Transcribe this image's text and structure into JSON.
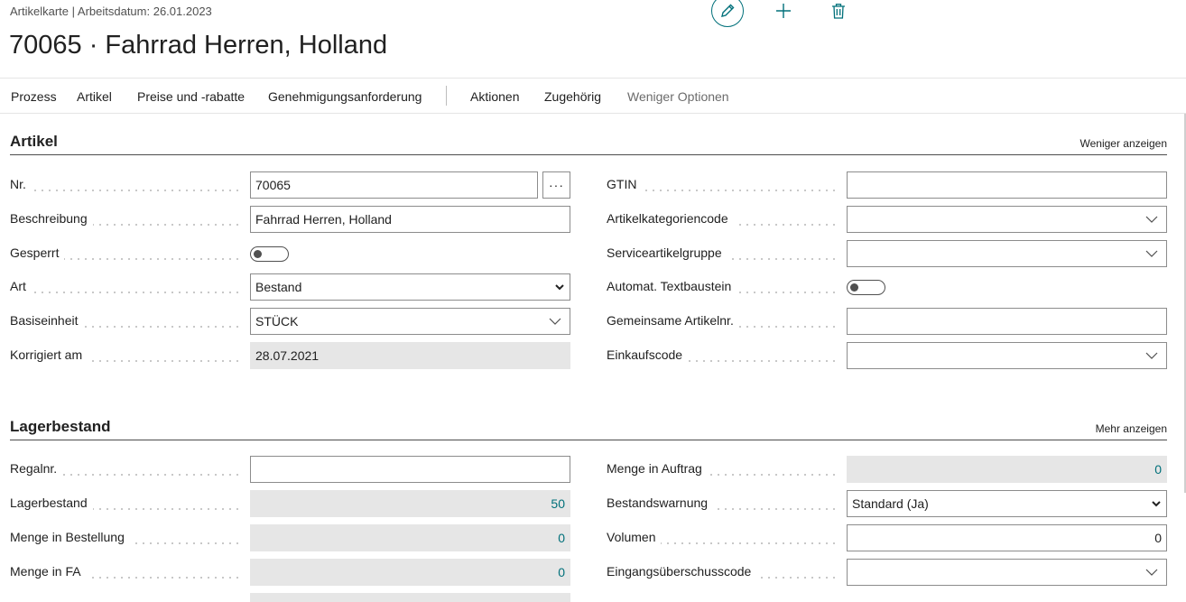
{
  "header": {
    "breadcrumb": "Artikelkarte | Arbeitsdatum: 26.01.2023",
    "title": "70065 · Fahrrad Herren, Holland",
    "icons": [
      "edit-pencil-icon",
      "add-plus-icon",
      "delete-trash-icon"
    ]
  },
  "actionbar": {
    "items": [
      "Prozess",
      "Artikel",
      "Preise und -rabatte",
      "Genehmigungsanforderung",
      "Aktionen",
      "Zugehörig",
      "Weniger Optionen"
    ]
  },
  "colors": {
    "accent": "#00707a",
    "readonly_bg": "#e6e6e6",
    "border": "#8c8c8c"
  },
  "artikel": {
    "title": "Artikel",
    "toggle_link": "Weniger anzeigen",
    "left": [
      {
        "label": "Nr.",
        "value": "70065"
      },
      {
        "label": "Beschreibung",
        "value": "Fahrrad Herren, Holland"
      },
      {
        "label": "Gesperrt",
        "value": "off"
      },
      {
        "label": "Art",
        "value": "Bestand"
      },
      {
        "label": "Basiseinheit",
        "value": "STÜCK"
      },
      {
        "label": "Korrigiert am",
        "value": "28.07.2021"
      }
    ],
    "right": [
      {
        "label": "GTIN",
        "value": ""
      },
      {
        "label": "Artikelkategoriencode",
        "value": ""
      },
      {
        "label": "Serviceartikelgruppe",
        "value": ""
      },
      {
        "label": "Automat. Textbaustein",
        "value": "off"
      },
      {
        "label": "Gemeinsame Artikelnr.",
        "value": ""
      },
      {
        "label": "Einkaufscode",
        "value": ""
      }
    ]
  },
  "lagerbestand": {
    "title": "Lagerbestand",
    "toggle_link": "Mehr anzeigen",
    "left": [
      {
        "label": "Regalnr.",
        "value": ""
      },
      {
        "label": "Lagerbestand",
        "value": "50"
      },
      {
        "label": "Menge in Bestellung",
        "value": "0"
      },
      {
        "label": "Menge in FA",
        "value": "0"
      }
    ],
    "right": [
      {
        "label": "Menge in Auftrag",
        "value": "0"
      },
      {
        "label": "Bestandswarnung",
        "value": "Standard (Ja)"
      },
      {
        "label": "Volumen",
        "value": "0"
      },
      {
        "label": "Eingangsüberschusscode",
        "value": ""
      }
    ]
  }
}
